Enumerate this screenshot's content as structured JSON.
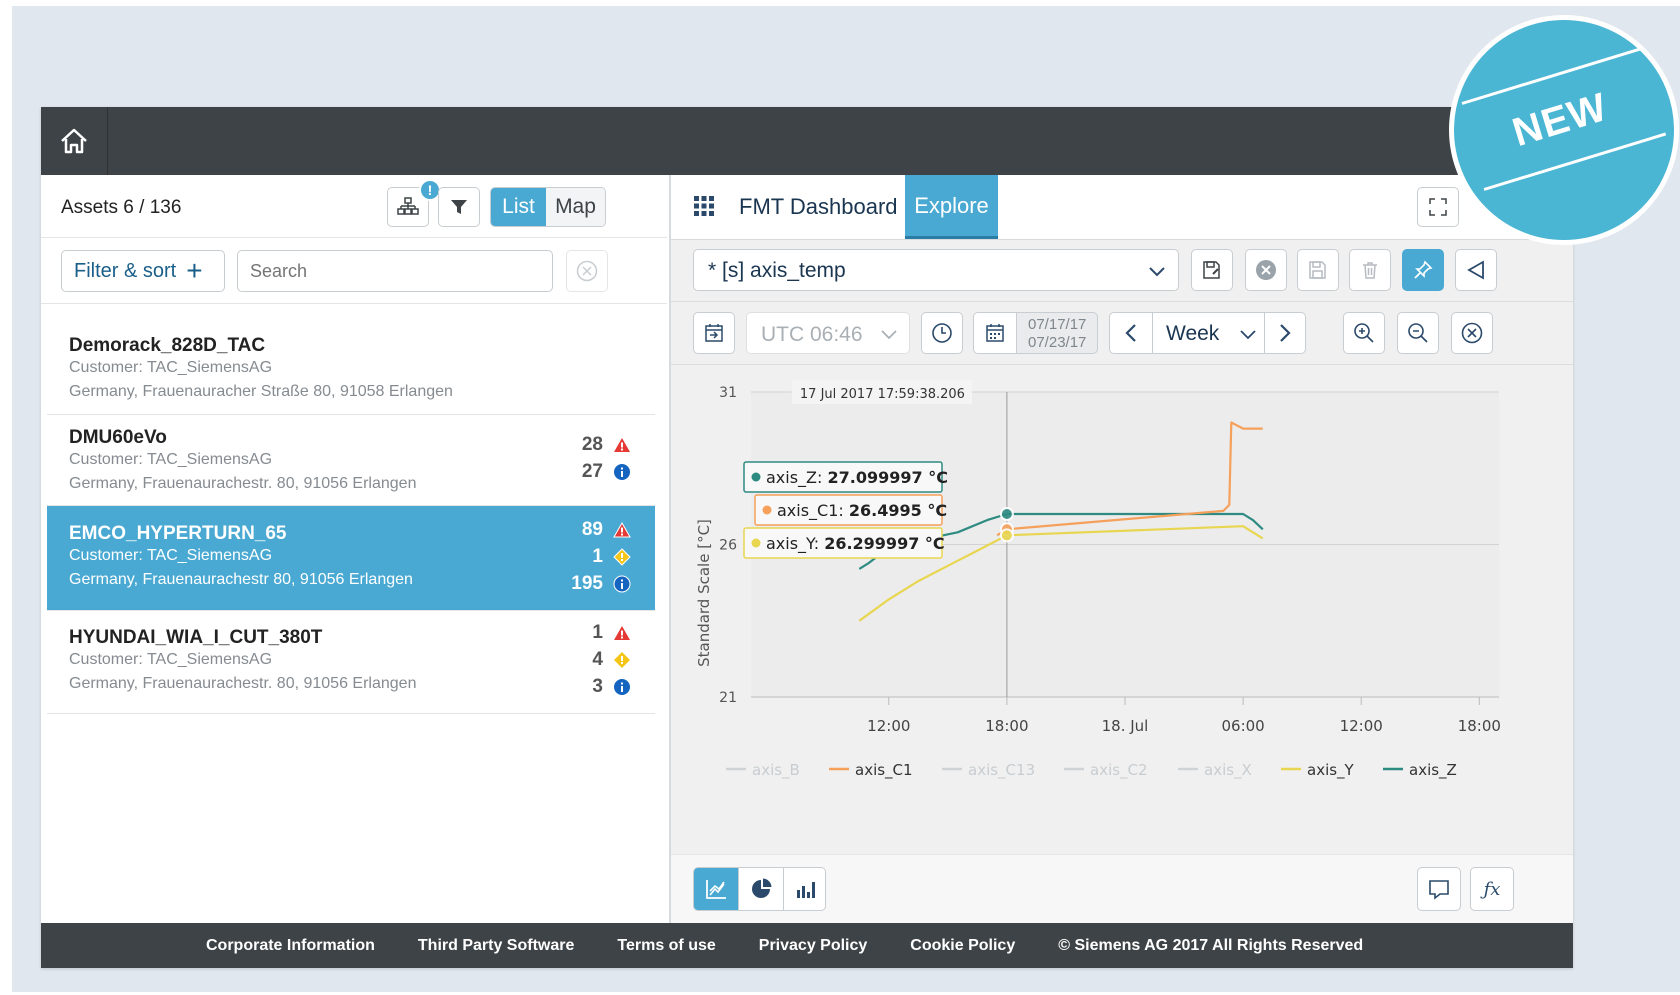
{
  "header": {
    "home_icon": "home-icon"
  },
  "assets_panel": {
    "count_label": "Assets 6 / 136",
    "view_toggle": {
      "list": "List",
      "map": "Map",
      "active": "List"
    },
    "hierarchy_badge": "!",
    "filter_sort_label": "Filter & sort",
    "search_placeholder": "Search",
    "items": [
      {
        "name": "Demorack_828D_TAC",
        "customer": "Customer: TAC_SiemensAG",
        "address": "Germany, Frauenauracher Straße 80, 91058 Erlangen",
        "counts": []
      },
      {
        "name": "DMU60eVo",
        "customer": "Customer: TAC_SiemensAG",
        "address": "Germany, Frauenaurachestr. 80, 91056 Erlangen",
        "counts": [
          {
            "value": "28",
            "type": "error"
          },
          {
            "value": "27",
            "type": "info"
          }
        ]
      },
      {
        "name": "EMCO_HYPERTURN_65",
        "customer": "Customer: TAC_SiemensAG",
        "address": "Germany, Frauenaurachestr 80, 91056 Erlangen",
        "selected": true,
        "counts": [
          {
            "value": "89",
            "type": "error"
          },
          {
            "value": "1",
            "type": "warning"
          },
          {
            "value": "195",
            "type": "info"
          }
        ]
      },
      {
        "name": "HYUNDAI_WIA_I_CUT_380T",
        "customer": "Customer: TAC_SiemensAG",
        "address": "Germany, Frauenaurachestr. 80, 91056 Erlangen",
        "counts": [
          {
            "value": "1",
            "type": "error"
          },
          {
            "value": "4",
            "type": "warning"
          },
          {
            "value": "3",
            "type": "info"
          }
        ]
      }
    ]
  },
  "explore": {
    "tabs": [
      {
        "label": "FMT Dashboard",
        "active": false
      },
      {
        "label": "Explore",
        "active": true
      }
    ],
    "query_select": "* [s] axis_temp",
    "timezone": "UTC 06:46",
    "date_from": "07/17/17",
    "date_to": "07/23/17",
    "range": "Week"
  },
  "badge": {
    "text": "NEW"
  },
  "colors": {
    "accent": "#49a9d2",
    "topbar": "#3d4347",
    "axis_C1": "#f5a05b",
    "axis_Y": "#e8d650",
    "axis_Z": "#2e8b82",
    "error": "#e53935",
    "warning": "#f5c518",
    "info": "#1565c0"
  },
  "chart_data": {
    "type": "line",
    "ylabel": "Standard Scale [°C]",
    "yticks": [
      "31",
      "26",
      "21"
    ],
    "ylim": [
      21,
      31
    ],
    "xticks": [
      "12:00",
      "18:00",
      "18. Jul",
      "06:00",
      "12:00",
      "18:00"
    ],
    "tooltip_time": "17 Jul 2017 17:59:38.206",
    "tooltip_values": [
      {
        "series": "axis_Z",
        "value": "27.099997 °C"
      },
      {
        "series": "axis_C1",
        "value": "26.4995 °C"
      },
      {
        "series": "axis_Y",
        "value": "26.299997 °C"
      }
    ],
    "legend": [
      {
        "name": "axis_B",
        "enabled": false
      },
      {
        "name": "axis_C1",
        "enabled": true
      },
      {
        "name": "axis_C13",
        "enabled": false
      },
      {
        "name": "axis_C2",
        "enabled": false
      },
      {
        "name": "axis_X",
        "enabled": false
      },
      {
        "name": "axis_Y",
        "enabled": true
      },
      {
        "name": "axis_Z",
        "enabled": true
      }
    ],
    "series": [
      {
        "name": "axis_Z",
        "points": [
          [
            -7.5,
            25.2
          ],
          [
            -7.0,
            25.4
          ],
          [
            -6.0,
            25.9
          ],
          [
            -4.0,
            26.2
          ],
          [
            -2.5,
            26.4
          ],
          [
            -1.0,
            26.8
          ],
          [
            0.0,
            27.0
          ],
          [
            12.0,
            27.0
          ],
          [
            12.5,
            26.8
          ],
          [
            13.0,
            26.5
          ]
        ]
      },
      {
        "name": "axis_C1",
        "points": [
          [
            -0.5,
            26.3
          ],
          [
            0.0,
            26.5
          ],
          [
            11.0,
            27.1
          ],
          [
            11.3,
            27.3
          ],
          [
            11.4,
            30.0
          ],
          [
            12.0,
            29.8
          ],
          [
            13.0,
            29.8
          ]
        ]
      },
      {
        "name": "axis_Y",
        "points": [
          [
            -7.5,
            23.5
          ],
          [
            -6.0,
            24.2
          ],
          [
            -4.5,
            24.8
          ],
          [
            -3.0,
            25.3
          ],
          [
            -1.5,
            25.8
          ],
          [
            0.0,
            26.3
          ],
          [
            12.0,
            26.6
          ],
          [
            12.5,
            26.4
          ],
          [
            13.0,
            26.2
          ]
        ]
      }
    ],
    "xlim_hours_from_tooltip": [
      -13,
      25
    ]
  },
  "footer": {
    "links": [
      "Corporate Information",
      "Third Party Software",
      "Terms of use",
      "Privacy Policy",
      "Cookie Policy"
    ],
    "copyright": "© Siemens AG 2017 All Rights Reserved"
  }
}
